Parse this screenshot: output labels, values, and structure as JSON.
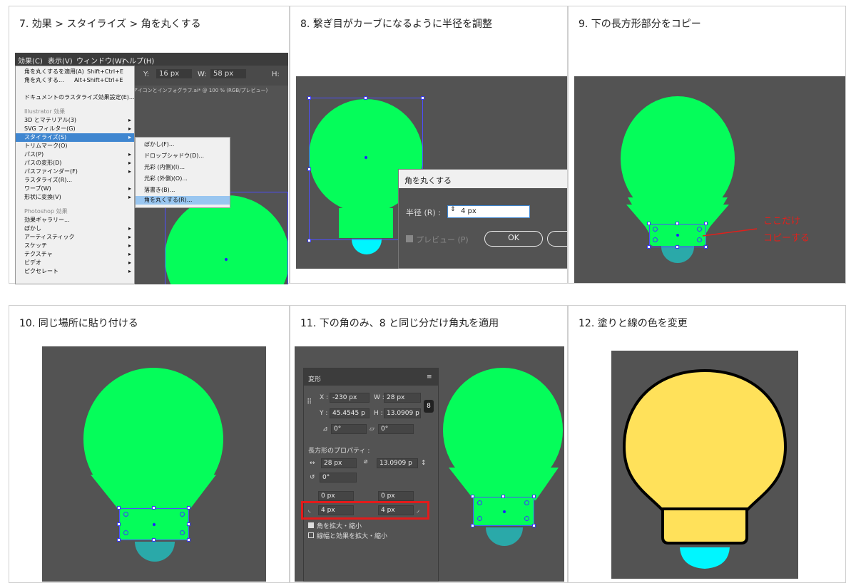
{
  "steps": [
    {
      "number": "7",
      "title": "7. 効果 > スタイライズ > 角を丸くする"
    },
    {
      "number": "8",
      "title": "8. 繋ぎ目がカーブになるように半径を調整"
    },
    {
      "number": "9",
      "title": "9. 下の長方形部分をコピー"
    },
    {
      "number": "10",
      "title": "10. 同じ場所に貼り付ける"
    },
    {
      "number": "11",
      "title": "11. 下の角のみ、8 と同じ分だけ角丸を適用"
    },
    {
      "number": "12",
      "title": "12. 塗りと線の色を変更"
    }
  ],
  "menubar": {
    "items": [
      "効果(C)",
      "表示(V)",
      "ウィンドウ(W)",
      "ヘルプ(H)"
    ]
  },
  "effect_menu": {
    "items": [
      {
        "label": "角を丸くするを適用(A)",
        "shortcut": "Shift+Ctrl+E"
      },
      {
        "label": "角を丸くする...",
        "shortcut": "Alt+Shift+Ctrl+E"
      },
      {
        "label": "ドキュメントのラスタライズ効果設定(E)..."
      },
      {
        "label": "Illustrator 効果",
        "header": true
      },
      {
        "label": "3D とマテリアル(3)",
        "arrow": true
      },
      {
        "label": "SVG フィルター(G)",
        "arrow": true
      },
      {
        "label": "スタイライズ(S)",
        "arrow": true,
        "highlight": true
      },
      {
        "label": "トリムマーク(O)"
      },
      {
        "label": "パス(P)",
        "arrow": true
      },
      {
        "label": "パスの変形(D)",
        "arrow": true
      },
      {
        "label": "パスファインダー(F)",
        "arrow": true
      },
      {
        "label": "ラスタライズ(R)..."
      },
      {
        "label": "ワープ(W)",
        "arrow": true
      },
      {
        "label": "形状に変換(V)",
        "arrow": true
      },
      {
        "label": "Photoshop 効果",
        "header": true
      },
      {
        "label": "効果ギャラリー..."
      },
      {
        "label": "ぼかし",
        "arrow": true
      },
      {
        "label": "アーティスティック",
        "arrow": true
      },
      {
        "label": "スケッチ",
        "arrow": true
      },
      {
        "label": "テクスチャ",
        "arrow": true
      },
      {
        "label": "ビデオ",
        "arrow": true
      },
      {
        "label": "ピクセレート",
        "arrow": true
      }
    ]
  },
  "stylize_submenu": {
    "items": [
      {
        "label": "ぼかし(F)..."
      },
      {
        "label": "ドロップシャドウ(D)..."
      },
      {
        "label": "光彩 (内側)(I)..."
      },
      {
        "label": "光彩 (外側)(O)..."
      },
      {
        "label": "落書き(B)..."
      },
      {
        "label": "角を丸くする(R)...",
        "highlight": true
      }
    ]
  },
  "control_bar": {
    "y_label": "Y:",
    "y_value": "16 px",
    "w_label": "W:",
    "w_value": "58 px",
    "h_label": "H:"
  },
  "doc_tab": "アイコンとインフォグラフ.ai* @ 100 % (RGB/プレビュー)",
  "round_dialog": {
    "title": "角を丸くする",
    "radius_label": "半径 (R) :",
    "radius_value": "4 px",
    "preview_label": "プレビュー (P)",
    "ok_label": "OK"
  },
  "annotation": {
    "line1": "ここだけ",
    "line2": "コピーする",
    "color": "#e0201b"
  },
  "transform_panel": {
    "title": "変形",
    "x_label": "X :",
    "x_value": "-230 px",
    "w_label": "W :",
    "w_value": "28 px",
    "y_label": "Y :",
    "y_value": "45.4545 p",
    "h_label": "H :",
    "h_value": "13.0909 p",
    "angle_value": "0°",
    "shear_value": "0°",
    "rect_props": "長方形のプロパティ :",
    "rw_value": "28 px",
    "rh_value": "13.0909 p",
    "rot_value": "0°",
    "tl_value": "0 px",
    "tr_value": "0 px",
    "bl_value": "4 px",
    "br_value": "4 px",
    "scale_corners": "角を拡大・縮小",
    "scale_strokes": "線幅と効果を拡大・縮小"
  },
  "colors": {
    "bulb_green": "#05fd5a",
    "cap_cyan": "#00f6ff",
    "cap_teal": "#2aa9a9",
    "bulb_yellow": "#ffe15a",
    "canvas_gray": "#535353",
    "highlight_red": "#e31b1b"
  }
}
